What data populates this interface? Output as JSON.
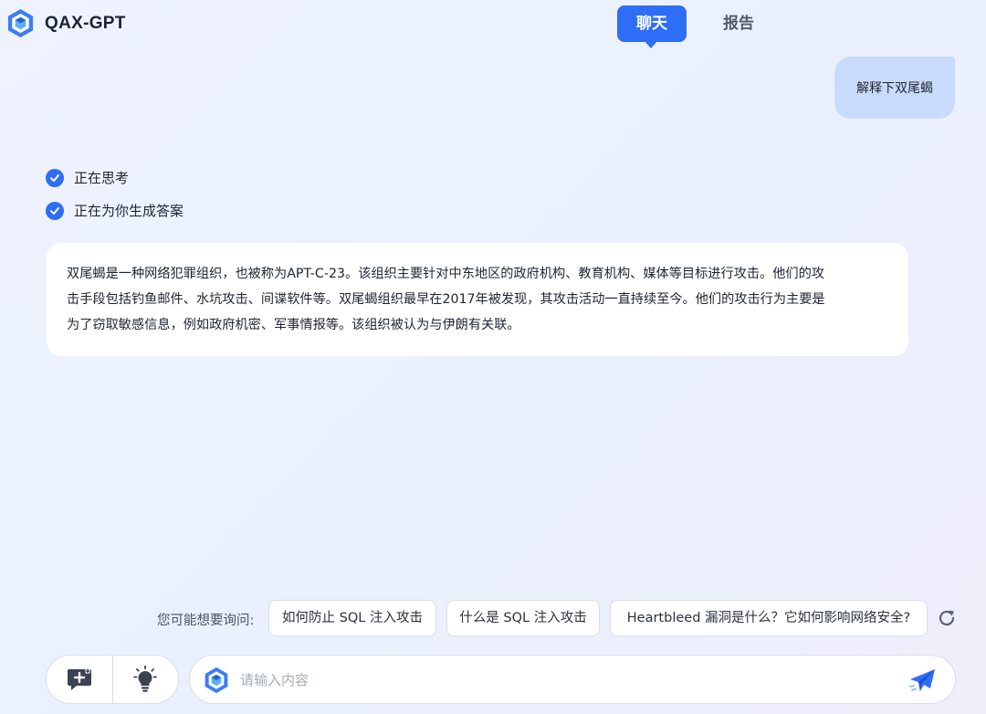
{
  "app": {
    "title": "QAX-GPT"
  },
  "tabs": [
    {
      "label": "聊天",
      "active": true
    },
    {
      "label": "报告",
      "active": false
    }
  ],
  "user_message": "解释下双尾蝎",
  "steps": [
    {
      "label": "正在思考",
      "status": "done"
    },
    {
      "label": "正在为你生成答案",
      "status": "done"
    }
  ],
  "answer": {
    "lines": [
      "双尾蝎是一种网络犯罪组织，也被称为APT-C-23。该组织主要针对中东地区的政府机构、教育机构、媒体等目标进行攻击。他们的攻",
      "击手段包括钓鱼邮件、水坑攻击、间谍软件等。双尾蝎组织最早在2017年被发现，其攻击活动一直持续至今。他们的攻击行为主要是",
      "为了窃取敏感信息，例如政府机密、军事情报等。该组织被认为与伊朗有关联。"
    ]
  },
  "suggestions": {
    "label": "您可能想要询问:",
    "items": [
      "如何防止 SQL 注入攻击",
      "什么是 SQL 注入攻击",
      "Heartbleed 漏洞是什么？它如何影响网络安全?"
    ]
  },
  "input": {
    "placeholder": "请输入内容",
    "value": ""
  },
  "icons": {
    "logo": "hexagon-logo-icon",
    "check": "check-circle-icon",
    "refresh": "refresh-icon",
    "new_chat": "chat-plus-icon",
    "idea": "lightbulb-icon",
    "send": "paper-plane-icon"
  },
  "colors": {
    "accent": "#2e6df6",
    "user_bubble": "#c9dbfb",
    "background": "#eef3ff"
  }
}
